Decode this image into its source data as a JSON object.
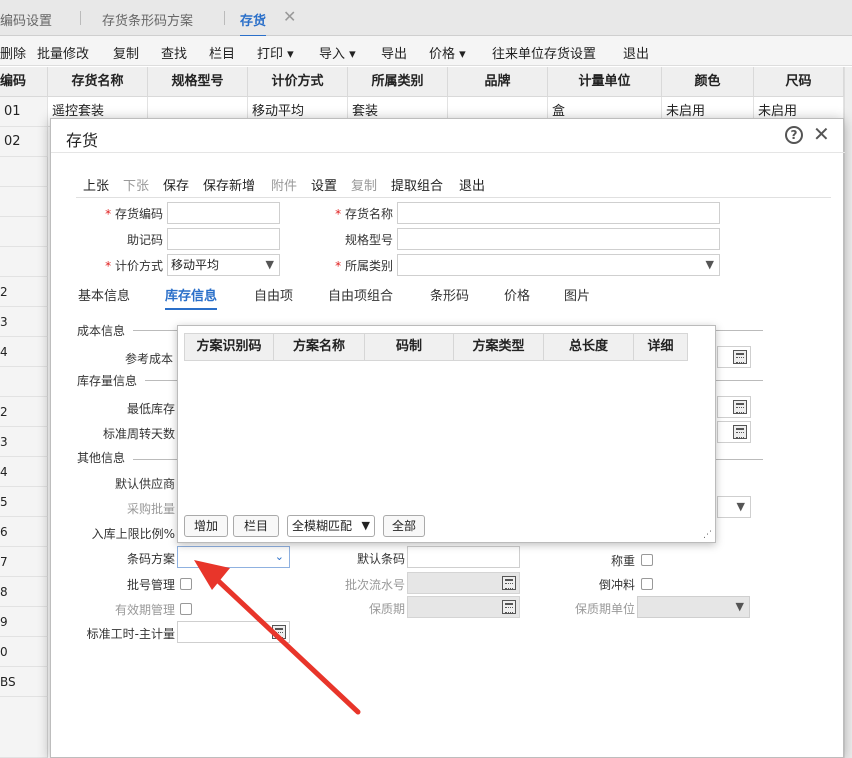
{
  "page_tabs": [
    {
      "label": "编码设置"
    },
    {
      "label": "存货条形码方案"
    },
    {
      "label": "存货"
    }
  ],
  "toolbar": [
    "删除",
    "批量修改",
    "复制",
    "查找",
    "栏目",
    "打印",
    "导入",
    "导出",
    "价格",
    "往来单位存货设置",
    "退出"
  ],
  "grid": {
    "headers": [
      "编码",
      "存货名称",
      "规格型号",
      "计价方式",
      "所属类别",
      "品牌",
      "计量单位",
      "颜色",
      "尺码"
    ],
    "rows": [
      [
        "01",
        "遥控套装",
        "",
        "移动平均",
        "套装",
        "",
        "盒",
        "未启用",
        "未启用"
      ],
      [
        "02",
        "",
        "",
        "",
        "",
        "",
        "",
        "",
        ""
      ]
    ],
    "row_codes": [
      "2",
      "3",
      "4",
      "2",
      "3",
      "4",
      "5",
      "6",
      "7",
      "8",
      "9",
      "0",
      "BS"
    ]
  },
  "dialog": {
    "title": "存货",
    "help_icon": "?",
    "close_icon": "✕",
    "toolbar": [
      {
        "label": "上张"
      },
      {
        "label": "下张"
      },
      {
        "label": "保存"
      },
      {
        "label": "保存新增"
      },
      {
        "label": "附件"
      },
      {
        "label": "设置"
      },
      {
        "label": "复制"
      },
      {
        "label": "提取组合"
      },
      {
        "label": "退出"
      }
    ],
    "fields": {
      "code_label": "存货编码",
      "code_value": "",
      "name_label": "存货名称",
      "name_value": "",
      "mnemonic_label": "助记码",
      "mnemonic_value": "",
      "spec_label": "规格型号",
      "spec_value": "",
      "valuation_label": "计价方式",
      "valuation_value": "移动平均",
      "category_label": "所属类别",
      "category_value": ""
    },
    "sub_tabs": [
      "基本信息",
      "库存信息",
      "自由项",
      "自由项组合",
      "条形码",
      "价格",
      "图片"
    ],
    "active_sub_tab": "库存信息",
    "sections": {
      "cost": "成本信息",
      "stock": "库存量信息",
      "other": "其他信息"
    },
    "labels": {
      "ref_cost": "参考成本",
      "min_stock": "最低库存",
      "std_turnover_days": "标准周转天数",
      "default_supplier": "默认供应商",
      "purchase_batch": "采购批量",
      "inbound_ratio": "入库上限比例%",
      "barcode_scheme": "条码方案",
      "default_barcode": "默认条码",
      "weigh": "称重",
      "batch_mgmt": "批号管理",
      "batch_serial": "批次流水号",
      "backflush": "倒冲料",
      "expiry_mgmt": "有效期管理",
      "shelf_life": "保质期",
      "shelf_life_unit": "保质期单位",
      "std_hours": "标准工时-主计量"
    },
    "popup": {
      "headers": [
        "方案识别码",
        "方案名称",
        "码制",
        "方案类型",
        "总长度",
        "详细"
      ],
      "buttons": {
        "add": "增加",
        "columns": "栏目",
        "match": "全模糊匹配",
        "all": "全部"
      }
    }
  },
  "colors": {
    "accent": "#2a6fc9",
    "required": "#e02020",
    "arrow": "#e8352a"
  }
}
